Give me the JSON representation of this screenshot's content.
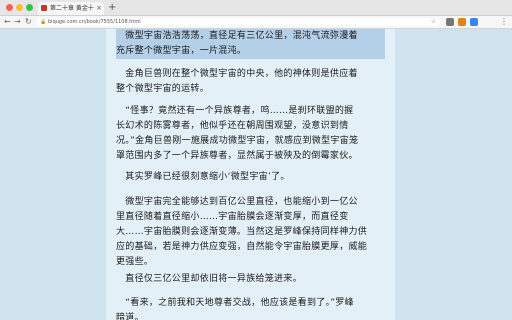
{
  "browser": {
    "tab_title": "第二十章 黄金十段 | 斗罗...",
    "tab_close": "×",
    "new_tab": "+",
    "back": "←",
    "forward": "→",
    "reload": "↻",
    "lock": "🔒",
    "url": "biquge.com.cn/book/7555/1108.html",
    "star": "☆",
    "menu": "⋮"
  },
  "article": {
    "paragraphs": [
      {
        "lines": [
          "　微型宇宙浩浩荡荡，直径足有三亿公里，混沌气流弥漫着",
          "充斥整个微型宇宙，一片混沌。"
        ],
        "highlighted": true
      },
      {
        "lines": [
          "　金角巨兽则在整个微型宇宙的中央，他的神体则是供应着",
          "整个微型宇宙的运转。"
        ]
      },
      {
        "lines": [
          "　“怪事？竟然还有一个异族尊者，呜……是刹环联盟的握",
          "长幻术的陈雾尊者，他似乎还在朝周围观望，没意识到情",
          "况。”金角巨兽刚一施展成功微型宇宙，就感应到微型宇宙笼",
          "罩范围内多了一个异族尊者，显然属于被殃及的倒霉家伙。"
        ]
      },
      {
        "lines": [
          "　其实罗峰已经很刻意缩小‘微型宇宙’了。"
        ]
      },
      {
        "lines": [
          "　微型宇宙完全能够达到百亿公里直径，也能缩小到一亿公",
          "里直径随着直径缩小……宇宙胎膜会逐渐变厚，而直径变",
          "大……宇宙胎膜则会逐渐变薄。当然这是罗峰保持同样神力供",
          "应的基础，若是神力供应变强，自然能令宇宙胎膜更厚，威能",
          "更强些。"
        ]
      },
      {
        "lines": [
          "　直径仅三亿公里却依旧将一异族给笼进来。"
        ]
      },
      {
        "lines": [
          "　“看来，之前我和天地尊者交战，他应该是看到了。”罗峰",
          "暗道。"
        ]
      }
    ]
  }
}
